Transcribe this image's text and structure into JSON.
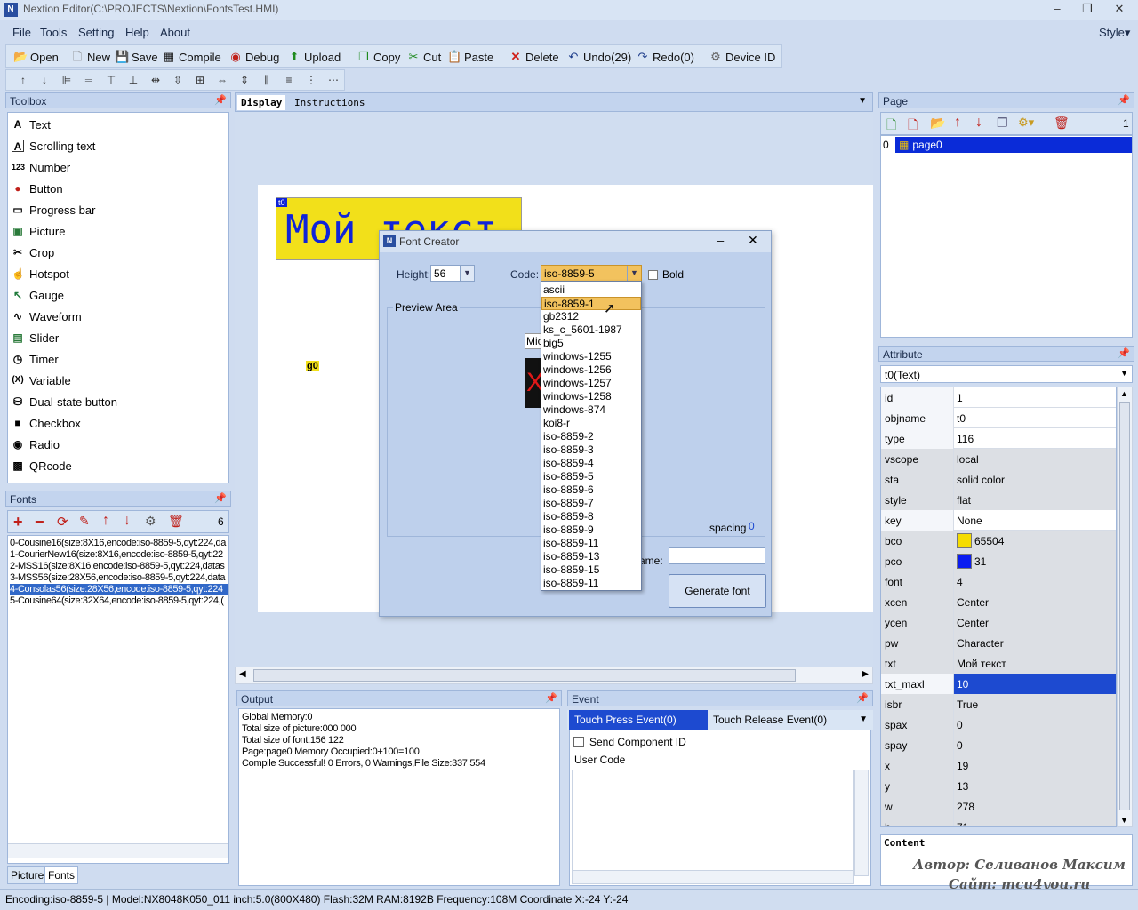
{
  "window": {
    "title": "Nextion Editor(C:\\PROJECTS\\Nextion\\FontsTest.HMI)",
    "style_label": "Style"
  },
  "menu": [
    "File",
    "Tools",
    "Setting",
    "Help",
    "About"
  ],
  "toolbar": {
    "open": "Open",
    "new": "New",
    "save": "Save",
    "compile": "Compile",
    "debug": "Debug",
    "upload": "Upload",
    "copy": "Copy",
    "cut": "Cut",
    "paste": "Paste",
    "delete": "Delete",
    "undo": "Undo(29)",
    "redo": "Redo(0)",
    "device_id": "Device  ID"
  },
  "toolbox": {
    "title": "Toolbox",
    "items": [
      {
        "label": "Text",
        "icon": "text-icon"
      },
      {
        "label": "Scrolling text",
        "icon": "scrolling-text-icon"
      },
      {
        "label": "Number",
        "icon": "number-icon"
      },
      {
        "label": "Button",
        "icon": "button-icon"
      },
      {
        "label": "Progress bar",
        "icon": "progress-bar-icon"
      },
      {
        "label": "Picture",
        "icon": "picture-icon"
      },
      {
        "label": "Crop",
        "icon": "crop-icon"
      },
      {
        "label": "Hotspot",
        "icon": "hotspot-icon"
      },
      {
        "label": "Gauge",
        "icon": "gauge-icon"
      },
      {
        "label": "Waveform",
        "icon": "waveform-icon"
      },
      {
        "label": "Slider",
        "icon": "slider-icon"
      },
      {
        "label": "Timer",
        "icon": "timer-icon"
      },
      {
        "label": "Variable",
        "icon": "variable-icon"
      },
      {
        "label": "Dual-state button",
        "icon": "dual-state-button-icon"
      },
      {
        "label": "Checkbox",
        "icon": "checkbox-icon"
      },
      {
        "label": "Radio",
        "icon": "radio-icon"
      },
      {
        "label": "QRcode",
        "icon": "qrcode-icon"
      }
    ]
  },
  "fonts": {
    "title": "Fonts",
    "count": "6",
    "items": [
      "0-Cousine16(size:8X16,encode:iso-8859-5,qyt:224,da",
      "1-CourierNew16(size:8X16,encode:iso-8859-5,qyt:22",
      "2-MSS16(size:8X16,encode:iso-8859-5,qyt:224,datas",
      "3-MSS56(size:28X56,encode:iso-8859-5,qyt:224,data",
      "4-Consolas56(size:28X56,encode:iso-8859-5,qyt:224",
      "5-Cousine64(size:32X64,encode:iso-8859-5,qyt:224,("
    ],
    "selected_index": 4
  },
  "bottom_tabs": [
    "Picture",
    "Fonts"
  ],
  "display": {
    "tabs": [
      "Display",
      "Instructions"
    ],
    "t0": {
      "tag": "t0",
      "text": "Мой текст"
    },
    "g0": {
      "text": "g0"
    }
  },
  "output": {
    "title": "Output",
    "lines": [
      "Global Memory:0",
      "Total size of picture:000 000",
      "Total size of font:156 122",
      "Page:page0 Memory Occupied:0+100=100",
      "Compile Successful! 0 Errors, 0 Warnings,File Size:337 554"
    ]
  },
  "event": {
    "title": "Event",
    "tabs": [
      "Touch Press Event(0)",
      "Touch Release Event(0)"
    ],
    "send_component_id": "Send Component ID",
    "user_code": "User Code"
  },
  "page": {
    "title": "Page",
    "count": "1",
    "items": [
      {
        "index": "0",
        "name": "page0"
      }
    ]
  },
  "attribute": {
    "title": "Attribute",
    "selected": "t0(Text)",
    "rows": [
      {
        "key": "id",
        "value": "1"
      },
      {
        "key": "objname",
        "value": "t0"
      },
      {
        "key": "type",
        "value": "116"
      },
      {
        "key": "vscope",
        "value": "local",
        "gray": true
      },
      {
        "key": "sta",
        "value": "solid color",
        "gray": true
      },
      {
        "key": "style",
        "value": "flat",
        "gray": true
      },
      {
        "key": "key",
        "value": "None"
      },
      {
        "key": "bco",
        "value": "65504",
        "color": "#f5dc00",
        "gray": true
      },
      {
        "key": "pco",
        "value": "31",
        "color": "#0b1cf0",
        "gray": true
      },
      {
        "key": "font",
        "value": "4",
        "gray": true
      },
      {
        "key": "xcen",
        "value": "Center",
        "gray": true
      },
      {
        "key": "ycen",
        "value": "Center",
        "gray": true
      },
      {
        "key": "pw",
        "value": "Character",
        "gray": true
      },
      {
        "key": "txt",
        "value": "Мой текст",
        "gray": true
      },
      {
        "key": "txt_maxl",
        "value": "10",
        "highlight": true
      },
      {
        "key": "isbr",
        "value": "True",
        "gray": true
      },
      {
        "key": "spax",
        "value": "0",
        "gray": true
      },
      {
        "key": "spay",
        "value": "0",
        "gray": true
      },
      {
        "key": "x",
        "value": "19",
        "gray": true
      },
      {
        "key": "y",
        "value": "13",
        "gray": true
      },
      {
        "key": "w",
        "value": "278",
        "gray": true
      },
      {
        "key": "h",
        "value": "71",
        "gray": true
      }
    ],
    "content_label": "Content",
    "watermark_author": "Автор: Селиванов Максим",
    "watermark_site": "Сайт: mcu4you.ru"
  },
  "statusbar": {
    "text": "Encoding:iso-8859-5 | Model:NX8048K050_011  inch:5.0(800X480) Flash:32M RAM:8192B Frequency:108M     Coordinate X:-24  Y:-24"
  },
  "font_creator": {
    "title": "Font Creator",
    "height_label": "Height:",
    "height_value": "56",
    "code_label": "Code:",
    "code_value": "iso-8859-5",
    "bold_label": "Bold",
    "preview_label": "Preview Area",
    "preview_text_fragment": "Mic",
    "spacing_label": "spacing",
    "spacing_value": "0",
    "name_label": "ame:",
    "generate_label": "Generate font",
    "code_options": [
      "ascii",
      "iso-8859-1",
      "gb2312",
      "ks_c_5601-1987",
      "big5",
      "windows-1255",
      "windows-1256",
      "windows-1257",
      "windows-1258",
      "windows-874",
      "koi8-r",
      "iso-8859-2",
      "iso-8859-3",
      "iso-8859-4",
      "iso-8859-5",
      "iso-8859-6",
      "iso-8859-7",
      "iso-8859-8",
      "iso-8859-9",
      "iso-8859-11",
      "iso-8859-13",
      "iso-8859-15",
      "iso-8859-11"
    ],
    "highlighted_option": 1
  }
}
